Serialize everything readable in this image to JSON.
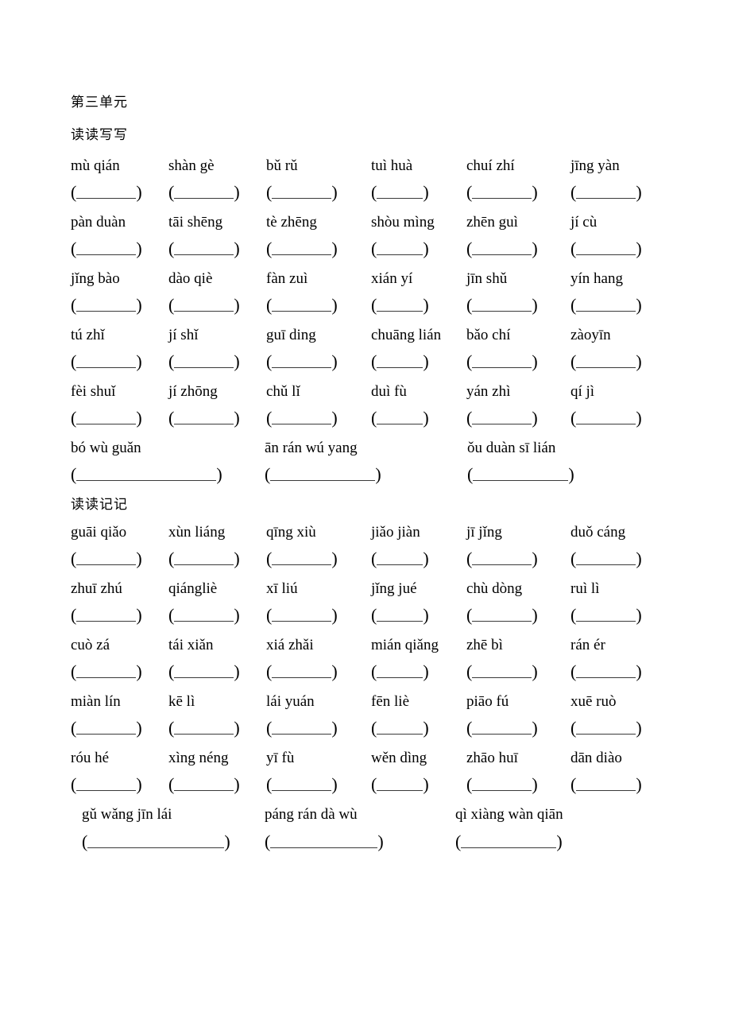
{
  "document": {
    "unit_title": "第三单元",
    "sections": [
      {
        "id": "dudu-xiexie",
        "heading": "读读写写",
        "rows": [
          {
            "type": "grid",
            "items": [
              "mù qián",
              "shàn gè",
              "bǔ rǔ",
              "tuì huà",
              "chuí zhí",
              "jīng yàn"
            ]
          },
          {
            "type": "grid",
            "items": [
              "pàn duàn",
              "tāi shēng",
              "tè zhēng",
              "shòu mìng",
              "zhēn guì",
              "jí cù"
            ]
          },
          {
            "type": "grid",
            "items": [
              "jǐng bào",
              "dào qiè",
              "fàn zuì",
              "xián yí",
              "jīn shǔ",
              "yín hang"
            ]
          },
          {
            "type": "grid",
            "items": [
              "tú zhǐ",
              "jí shǐ",
              "guī ding",
              "chuāng lián",
              "bǎo chí",
              "zàoyīn"
            ]
          },
          {
            "type": "grid",
            "items": [
              "fèi shuǐ",
              "jí zhōng",
              "chǔ lǐ",
              "duì fù",
              "yán zhì",
              "qí jì"
            ]
          },
          {
            "type": "wide",
            "items": [
              "bó wù guǎn",
              "ān rán wú yang",
              "ǒu duàn sī lián"
            ]
          }
        ]
      },
      {
        "id": "dudu-jiji",
        "heading": "读读记记",
        "rows": [
          {
            "type": "grid",
            "items": [
              "guāi qiǎo",
              "xùn liáng",
              "qīng xiù",
              "jiǎo jiàn",
              "jī jǐng",
              "duǒ cáng"
            ]
          },
          {
            "type": "grid",
            "items": [
              "zhuī zhú",
              "qiángliè",
              "xī liú",
              "jǐng jué",
              "chù dòng",
              "ruì lì"
            ]
          },
          {
            "type": "grid",
            "items": [
              "cuò zá",
              "tái xiǎn",
              "xiá zhǎi",
              "mián qiǎng",
              "zhē bì",
              "rán ér"
            ]
          },
          {
            "type": "grid",
            "items": [
              "miàn lín",
              "kē lì",
              "lái yuán",
              "fēn liè",
              "piāo fú",
              "xuē ruò"
            ]
          },
          {
            "type": "grid",
            "items": [
              "róu hé",
              "xìng néng",
              "yī fù",
              "wěn dìng",
              "zhāo huī",
              "dān diào"
            ]
          },
          {
            "type": "wide-last",
            "items": [
              "gǔ wǎng jīn lái",
              "páng rán dà wù",
              "qì xiàng wàn qiān"
            ]
          }
        ]
      }
    ]
  },
  "style": {
    "rule_color": "#3a3a3a",
    "text_color": "#000000",
    "background": "#ffffff"
  }
}
